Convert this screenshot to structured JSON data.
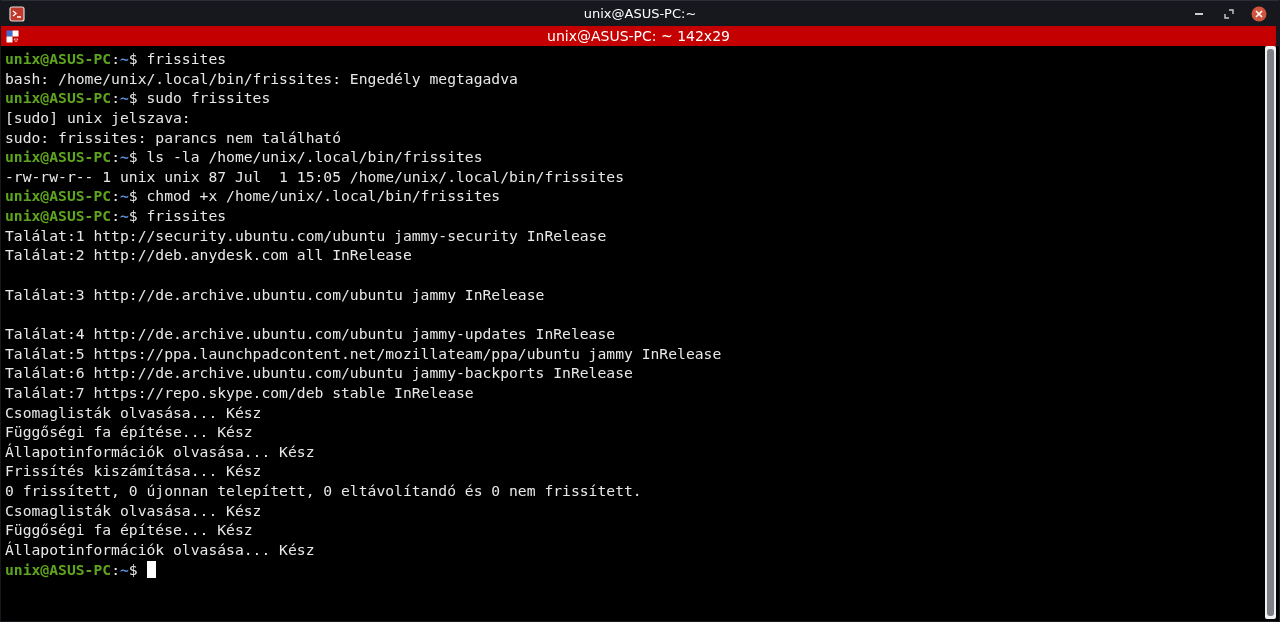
{
  "window": {
    "title": "unix@ASUS-PC:~"
  },
  "tab": {
    "title": "unix@ASUS-PC: ~ 142x29"
  },
  "lines": [
    {
      "kind": "prompt",
      "host": "unix@ASUS-PC",
      "sep": ":",
      "path": "~",
      "symbol": "$",
      "command": "frissites"
    },
    {
      "kind": "output",
      "text": "bash: /home/unix/.local/bin/frissites: Engedély megtagadva"
    },
    {
      "kind": "prompt",
      "host": "unix@ASUS-PC",
      "sep": ":",
      "path": "~",
      "symbol": "$",
      "command": "sudo frissites"
    },
    {
      "kind": "output",
      "text": "[sudo] unix jelszava:"
    },
    {
      "kind": "output",
      "text": "sudo: frissites: parancs nem található"
    },
    {
      "kind": "prompt",
      "host": "unix@ASUS-PC",
      "sep": ":",
      "path": "~",
      "symbol": "$",
      "command": "ls -la /home/unix/.local/bin/frissites"
    },
    {
      "kind": "output",
      "text": "-rw-rw-r-- 1 unix unix 87 Jul  1 15:05 /home/unix/.local/bin/frissites"
    },
    {
      "kind": "prompt",
      "host": "unix@ASUS-PC",
      "sep": ":",
      "path": "~",
      "symbol": "$",
      "command": "chmod +x /home/unix/.local/bin/frissites"
    },
    {
      "kind": "prompt",
      "host": "unix@ASUS-PC",
      "sep": ":",
      "path": "~",
      "symbol": "$",
      "command": "frissites"
    },
    {
      "kind": "output",
      "text": "Találat:1 http://security.ubuntu.com/ubuntu jammy-security InRelease"
    },
    {
      "kind": "output",
      "text": "Találat:2 http://deb.anydesk.com all InRelease"
    },
    {
      "kind": "blank"
    },
    {
      "kind": "output",
      "text": "Találat:3 http://de.archive.ubuntu.com/ubuntu jammy InRelease"
    },
    {
      "kind": "blank"
    },
    {
      "kind": "output",
      "text": "Találat:4 http://de.archive.ubuntu.com/ubuntu jammy-updates InRelease"
    },
    {
      "kind": "output",
      "text": "Találat:5 https://ppa.launchpadcontent.net/mozillateam/ppa/ubuntu jammy InRelease"
    },
    {
      "kind": "output",
      "text": "Találat:6 http://de.archive.ubuntu.com/ubuntu jammy-backports InRelease"
    },
    {
      "kind": "output",
      "text": "Találat:7 https://repo.skype.com/deb stable InRelease"
    },
    {
      "kind": "output",
      "text": "Csomaglisták olvasása... Kész"
    },
    {
      "kind": "output",
      "text": "Függőségi fa építése... Kész"
    },
    {
      "kind": "output",
      "text": "Állapotinformációk olvasása... Kész"
    },
    {
      "kind": "output",
      "text": "Frissítés kiszámítása... Kész"
    },
    {
      "kind": "output",
      "text": "0 frissített, 0 újonnan telepített, 0 eltávolítandó és 0 nem frissített."
    },
    {
      "kind": "output",
      "text": "Csomaglisták olvasása... Kész"
    },
    {
      "kind": "output",
      "text": "Függőségi fa építése... Kész"
    },
    {
      "kind": "output",
      "text": "Állapotinformációk olvasása... Kész"
    },
    {
      "kind": "prompt",
      "host": "unix@ASUS-PC",
      "sep": ":",
      "path": "~",
      "symbol": "$",
      "cursor": true
    }
  ]
}
